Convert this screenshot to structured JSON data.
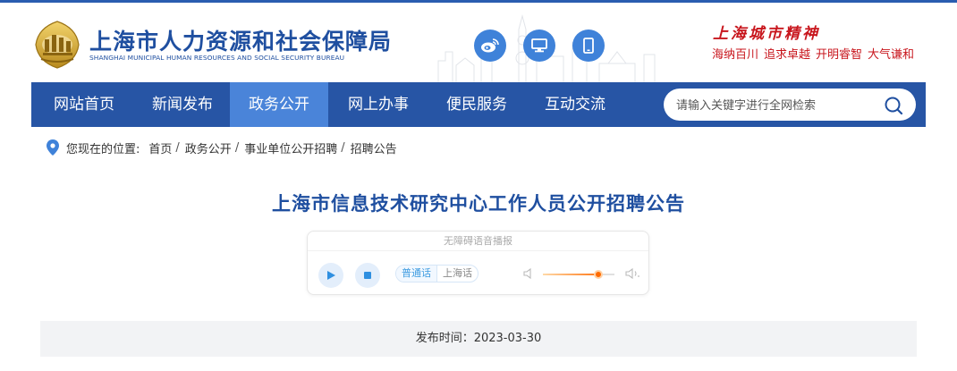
{
  "header": {
    "title": "上海市人力资源和社会保障局",
    "subtitle": "SHANGHAI MUNICIPAL HUMAN RESOURCES AND SOCIAL SECURITY BUREAU",
    "emblem_text": "山",
    "quick_icons": [
      "weibo-icon",
      "desktop-icon",
      "mobile-icon"
    ],
    "spirit": {
      "title": "上海城市精神",
      "words": [
        "海纳百川",
        "追求卓越",
        "开明睿智",
        "大气谦和"
      ]
    }
  },
  "nav": {
    "items": [
      {
        "label": "网站首页",
        "active": false
      },
      {
        "label": "新闻发布",
        "active": false
      },
      {
        "label": "政务公开",
        "active": true
      },
      {
        "label": "网上办事",
        "active": false
      },
      {
        "label": "便民服务",
        "active": false
      },
      {
        "label": "互动交流",
        "active": false
      }
    ],
    "search_placeholder": "请输入关键字进行全网检索"
  },
  "breadcrumb": {
    "label": "您现在的位置:",
    "items": [
      "首页",
      "政务公开",
      "事业单位公开招聘",
      "招聘公告"
    ],
    "separator": "/"
  },
  "article": {
    "title": "上海市信息技术研究中心工作人员公开招聘公告",
    "publish_label": "发布时间:",
    "publish_date": "2023-03-30",
    "publish_text": "发布时间：2023-03-30"
  },
  "player": {
    "header": "无障碍语音播报",
    "languages": [
      {
        "label": "普通话",
        "active": true
      },
      {
        "label": "上海话",
        "active": false
      }
    ],
    "volume": 0.78
  },
  "colors": {
    "brand_blue": "#2755a5",
    "nav_active": "#4a84d9",
    "spirit_red": "#c8161d",
    "volume_orange": "#ff6a00"
  }
}
